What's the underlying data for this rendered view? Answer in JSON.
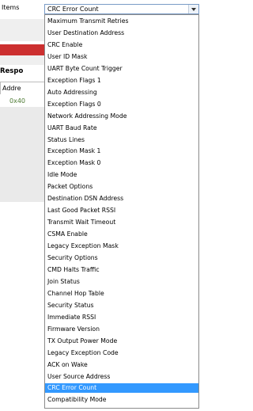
{
  "field": {
    "label": "Items",
    "selected_value": "CRC Error Count"
  },
  "background": {
    "response_label": "Respo",
    "address_header": "Addre",
    "address_value": "0x40"
  },
  "dropdown": {
    "options": [
      "Maximum Transmit Retries",
      "User Destination Address",
      "CRC Enable",
      "User ID Mask",
      "UART Byte Count Trigger",
      "Exception Flags 1",
      "Auto Addressing",
      "Exception Flags 0",
      "Network Addressing Mode",
      "UART Baud Rate",
      "Status Lines",
      "Exception Mask 1",
      "Exception Mask 0",
      "Idle Mode",
      "Packet Options",
      "Destination DSN Address",
      "Last Good Packet RSSI",
      "Transmit Wait Timeout",
      "CSMA Enable",
      "Legacy Exception Mask",
      "Security Options",
      "CMD Halts Traffic",
      "Join Status",
      "Channel Hop Table",
      "Security Status",
      "Immediate RSSI",
      "Firmware Version",
      "TX Output Power Mode",
      "Legacy Exception Code",
      "ACK on Wake",
      "User Source Address",
      "CRC Error Count",
      "Compatibility Mode"
    ],
    "selected_index": 31
  },
  "colors": {
    "selection": "#3399ff",
    "red_strip": "#cc2f2f",
    "hex_value": "#4d7a33"
  }
}
